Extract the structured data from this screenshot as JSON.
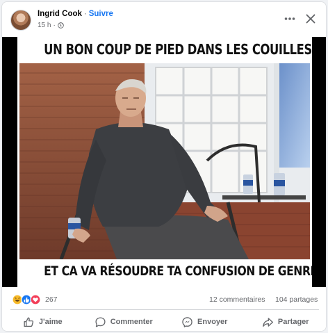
{
  "post": {
    "author": "Ingrid Cook",
    "separator": "·",
    "follow_label": "Suivre",
    "time": "15 h",
    "meta_separator": "·",
    "privacy_icon": "globe-icon"
  },
  "header_actions": {
    "more_icon": "more-horizontal-icon",
    "close_icon": "close-icon"
  },
  "meme": {
    "top_caption": "UN BON COUP DE PIED DANS LES COUILLES",
    "bottom_caption": "ET CA VA RÉSOUDRE TA CONFUSION DE GENRE"
  },
  "stats": {
    "reaction_icons": [
      "haha-icon",
      "like-icon",
      "love-icon"
    ],
    "reaction_count": "267",
    "comments": "12 commentaires",
    "shares": "104 partages"
  },
  "actions": [
    {
      "label": "J'aime",
      "icon": "thumbs-up-icon"
    },
    {
      "label": "Commenter",
      "icon": "comment-icon"
    },
    {
      "label": "Envoyer",
      "icon": "messenger-icon"
    },
    {
      "label": "Partager",
      "icon": "share-icon"
    }
  ],
  "colors": {
    "accent": "#1877f2",
    "secondary_text": "#65676b",
    "like_blue": "#1877f2",
    "love_red": "#f33e58",
    "haha_yellow": "#f7b928"
  }
}
